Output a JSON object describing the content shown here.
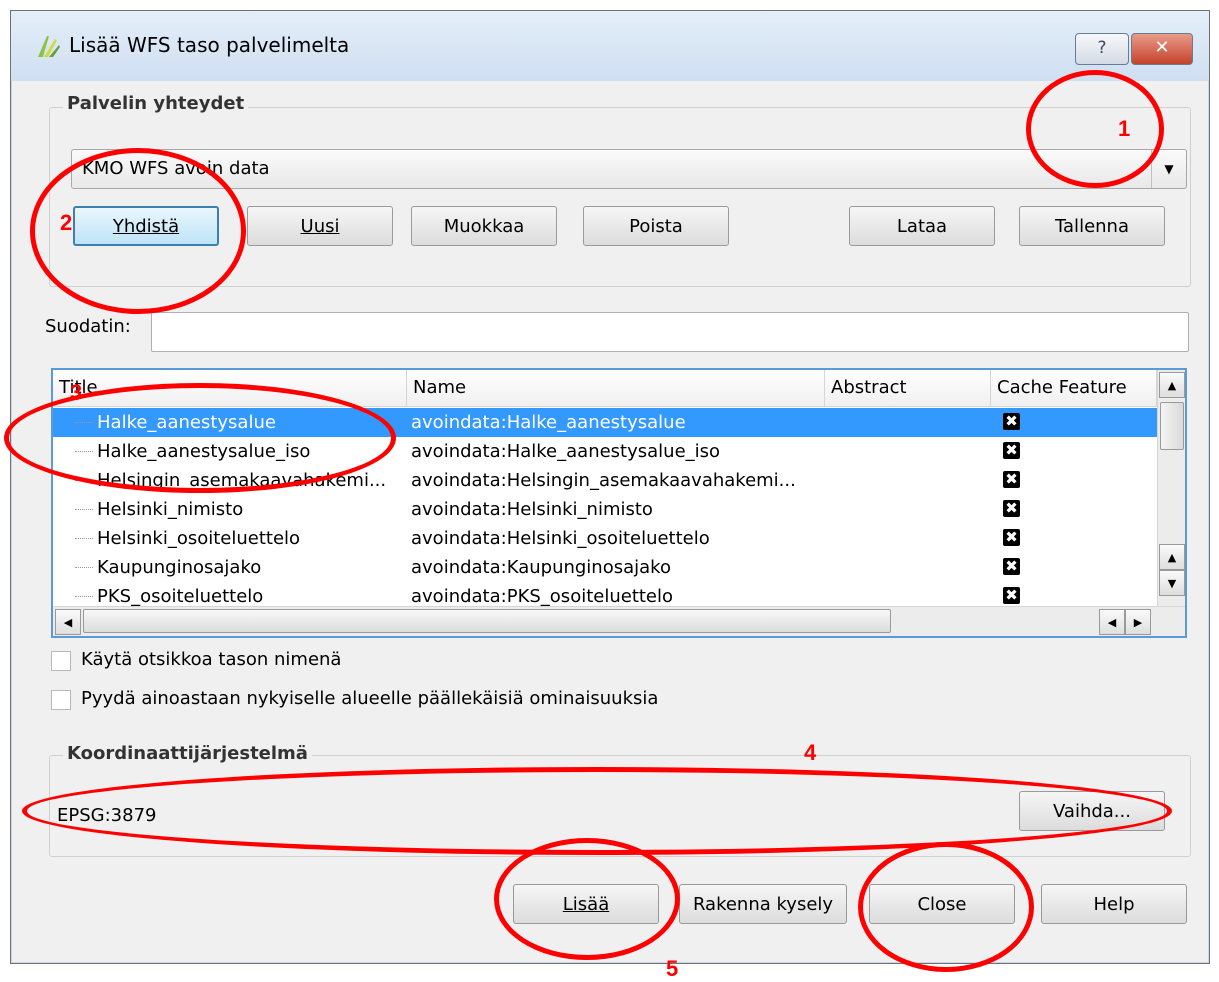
{
  "window": {
    "title": "Lisää WFS taso palvelimelta",
    "help_symbol": "?",
    "close_symbol": "✕"
  },
  "connections": {
    "group_title": "Palvelin yhteydet",
    "selected": "KMO WFS avoin data",
    "buttons": {
      "connect": "Yhdistä",
      "new": "Uusi",
      "edit": "Muokkaa",
      "delete": "Poista",
      "load": "Lataa",
      "save": "Tallenna"
    }
  },
  "filter": {
    "label": "Suodatin:",
    "value": ""
  },
  "table": {
    "columns": [
      "Title",
      "Name",
      "Abstract",
      "Cache Feature"
    ],
    "rows": [
      {
        "title": "Halke_aanestysalue",
        "name": "avoindata:Halke_aanestysalue",
        "abstract": "",
        "cache": true,
        "selected": true
      },
      {
        "title": "Halke_aanestysalue_iso",
        "name": "avoindata:Halke_aanestysalue_iso",
        "abstract": "",
        "cache": true
      },
      {
        "title": "Helsingin_asemakaavahakemi...",
        "name": "avoindata:Helsingin_asemakaavahakemi...",
        "abstract": "",
        "cache": true
      },
      {
        "title": "Helsinki_nimisto",
        "name": "avoindata:Helsinki_nimisto",
        "abstract": "",
        "cache": true
      },
      {
        "title": "Helsinki_osoiteluettelo",
        "name": "avoindata:Helsinki_osoiteluettelo",
        "abstract": "",
        "cache": true
      },
      {
        "title": "Kaupunginosajako",
        "name": "avoindata:Kaupunginosajako",
        "abstract": "",
        "cache": true
      },
      {
        "title": "PKS_osoiteluettelo",
        "name": "avoindata:PKS_osoiteluettelo",
        "abstract": "",
        "cache": true
      }
    ]
  },
  "options": {
    "use_title": {
      "label": "Käytä otsikkoa tason nimenä",
      "checked": false
    },
    "only_intersecting": {
      "label": "Pyydä ainoastaan nykyiselle alueelle päällekäisiä ominaisuuksia",
      "checked": false
    }
  },
  "crs": {
    "group_title": "Koordinaattijärjestelmä",
    "value": "EPSG:3879",
    "change_button": "Vaihda..."
  },
  "footer": {
    "add": "Lisää",
    "build_query": "Rakenna kysely",
    "close": "Close",
    "help": "Help"
  },
  "annotations": [
    "1",
    "2",
    "3",
    "4",
    "5"
  ],
  "colors": {
    "annotation": "#ff0000",
    "selection": "#3399ff",
    "default_button_border": "#3c7fb1"
  }
}
